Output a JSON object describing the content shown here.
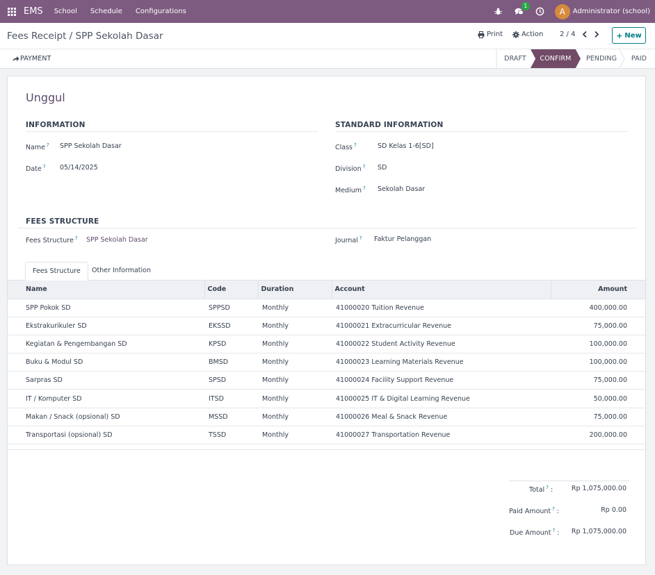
{
  "navbar": {
    "brand": "EMS",
    "menus": [
      "School",
      "Schedule",
      "Configurations"
    ],
    "messages_badge": "1",
    "avatar_letter": "A",
    "user": "Administrator (school)"
  },
  "control": {
    "breadcrumb": "Fees Receipt / SPP Sekolah Dasar",
    "print_label": "Print",
    "action_label": "Action",
    "pager": "2 / 4",
    "new_label": "New"
  },
  "statusbar": {
    "payment_label": "PAYMENT",
    "stages": [
      "DRAFT",
      "CONFIRM",
      "PENDING",
      "PAID"
    ],
    "active_stage": "CONFIRM"
  },
  "record": {
    "title": "Unggul",
    "information_title": "INFORMATION",
    "standard_title": "STANDARD INFORMATION",
    "fees_structure_title": "FEES STRUCTURE",
    "fields": {
      "name_label": "Name",
      "name_value": "SPP Sekolah Dasar",
      "date_label": "Date",
      "date_value": "05/14/2025",
      "class_label": "Class",
      "class_value": "SD Kelas 1-6[SD]",
      "division_label": "Division",
      "division_value": "SD",
      "medium_label": "Medium",
      "medium_value": "Sekolah Dasar",
      "fees_structure_label": "Fees Structure",
      "fees_structure_value": "SPP Sekolah Dasar",
      "journal_label": "Journal",
      "journal_value": "Faktur Pelanggan"
    },
    "help_mark": "?"
  },
  "tabs": [
    "Fees Structure",
    "Other Information"
  ],
  "table": {
    "columns": [
      "Name",
      "Code",
      "Duration",
      "Account",
      "Amount"
    ],
    "rows": [
      [
        "SPP Pokok SD",
        "SPPSD",
        "Monthly",
        "41000020 Tuition Revenue",
        "400,000.00"
      ],
      [
        "Ekstrakurikuler SD",
        "EKSSD",
        "Monthly",
        "41000021 Extracurricular Revenue",
        "75,000.00"
      ],
      [
        "Kegiatan & Pengembangan SD",
        "KPSD",
        "Monthly",
        "41000022 Student Activity Revenue",
        "100,000.00"
      ],
      [
        "Buku & Modul SD",
        "BMSD",
        "Monthly",
        "41000023 Learning Materials Revenue",
        "100,000.00"
      ],
      [
        "Sarpras SD",
        "SPSD",
        "Monthly",
        "41000024 Facility Support Revenue",
        "75,000.00"
      ],
      [
        "IT / Komputer SD",
        "ITSD",
        "Monthly",
        "41000025 IT & Digital Learning Revenue",
        "50,000.00"
      ],
      [
        "Makan / Snack (opsional) SD",
        "MSSD",
        "Monthly",
        "41000026 Meal & Snack Revenue",
        "75,000.00"
      ],
      [
        "Transportasi (opsional) SD",
        "TSSD",
        "Monthly",
        "41000027 Transportation Revenue",
        "200,000.00"
      ]
    ]
  },
  "totals": {
    "total_label": "Total",
    "total_value": "Rp 1,075,000.00",
    "paid_label": "Paid Amount",
    "paid_value": "Rp 0.00",
    "due_label": "Due Amount",
    "due_value": "Rp 1,075,000.00",
    "colon": ":"
  },
  "colors": {
    "navbar": "#7d5a80",
    "active_stage": "#714b67",
    "primary_teal": "#017e84",
    "link_purple": "#5d4a6d"
  }
}
